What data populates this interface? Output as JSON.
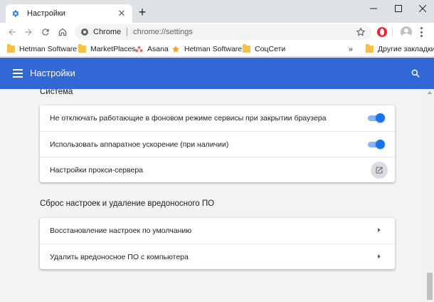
{
  "colors": {
    "accent": "#3367d6",
    "toggle_on": "#1a73e8",
    "page_bg": "#f1f3f4"
  },
  "tab": {
    "title": "Настройки",
    "favicon": "gear-icon"
  },
  "omnibox": {
    "origin": "Chrome",
    "url": "chrome://settings"
  },
  "bookmarks": {
    "items": [
      {
        "label": "Hetman Software",
        "icon": "folder-icon"
      },
      {
        "label": "MarketPlaces",
        "icon": "folder-icon"
      },
      {
        "label": "Asana",
        "icon": "asana-icon"
      },
      {
        "label": "Hetman Software",
        "icon": "star-icon"
      },
      {
        "label": "СоцСети",
        "icon": "folder-icon"
      }
    ],
    "overflow": "»",
    "other": "Другие закладки"
  },
  "header": {
    "title": "Настройки"
  },
  "system": {
    "title": "Система",
    "rows": [
      {
        "label": "Не отключать работающие в фоновом режиме сервисы при закрытии браузера",
        "control": "toggle",
        "on": true
      },
      {
        "label": "Использовать аппаратное ускорение (при наличии)",
        "control": "toggle",
        "on": true
      },
      {
        "label": "Настройки прокси-сервера",
        "control": "external-link"
      }
    ]
  },
  "reset": {
    "title": "Сброс настроек и удаление вредоносного ПО",
    "rows": [
      {
        "label": "Восстановление настроек по умолчанию",
        "control": "arrow"
      },
      {
        "label": "Удалить вредоносное ПО с компьютера",
        "control": "arrow"
      }
    ]
  }
}
